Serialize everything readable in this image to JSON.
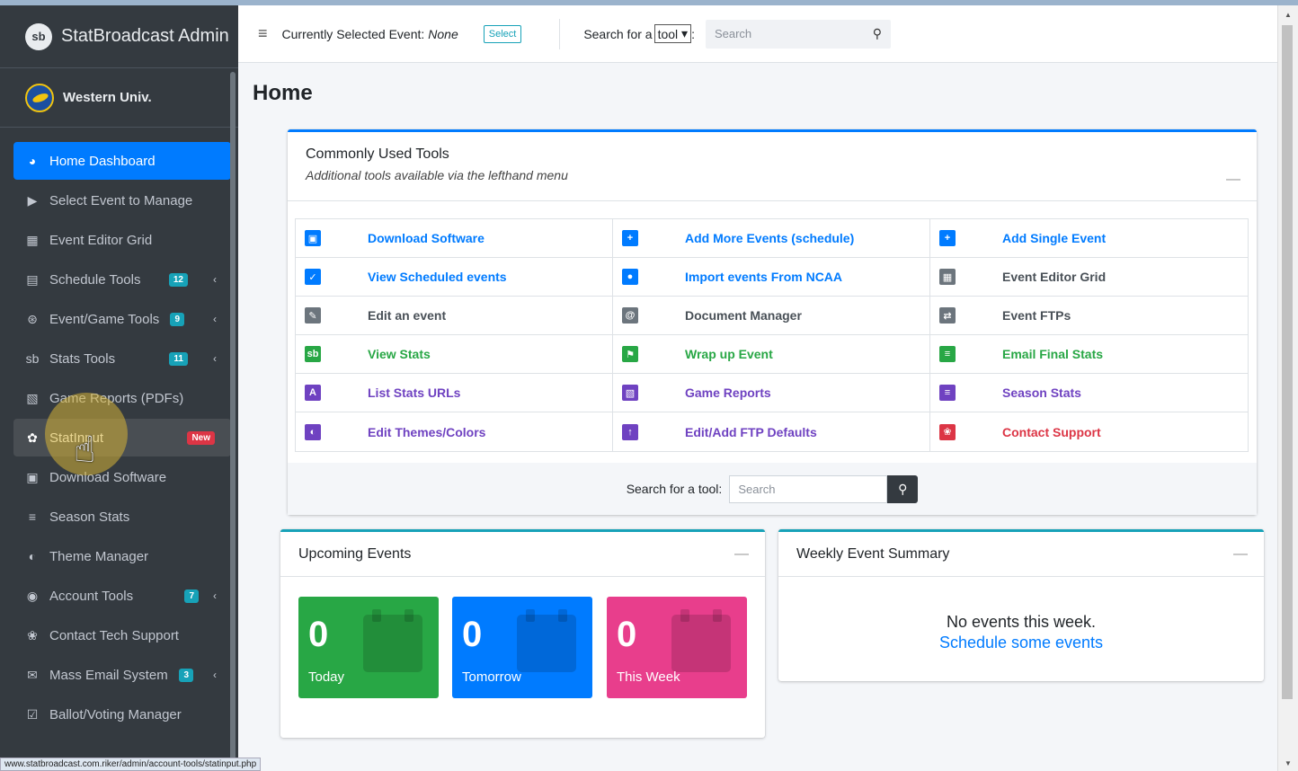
{
  "brand": {
    "title": "StatBroadcast Admin",
    "logo_text": "sb"
  },
  "user": {
    "name": "Western Univ."
  },
  "sidebar": {
    "items": [
      {
        "label": "Home Dashboard",
        "icon": "◕",
        "active": true
      },
      {
        "label": "Select Event to Manage",
        "icon": "▶"
      },
      {
        "label": "Event Editor Grid",
        "icon": "▦"
      },
      {
        "label": "Schedule Tools",
        "icon": "▤",
        "badge": "12",
        "chevron": "‹"
      },
      {
        "label": "Event/Game Tools",
        "icon": "⊛",
        "badge": "9",
        "chevron": "‹"
      },
      {
        "label": "Stats Tools",
        "icon": "sb",
        "badge": "11",
        "chevron": "‹"
      },
      {
        "label": "Game Reports (PDFs)",
        "icon": "▧"
      },
      {
        "label": "StatInput",
        "icon": "✿",
        "badge": "New",
        "hover": true
      },
      {
        "label": "Download Software",
        "icon": "▣"
      },
      {
        "label": "Season Stats",
        "icon": "≡"
      },
      {
        "label": "Theme Manager",
        "icon": "◐"
      },
      {
        "label": "Account Tools",
        "icon": "◉",
        "badge": "7",
        "chevron": "‹"
      },
      {
        "label": "Contact Tech Support",
        "icon": "❀"
      },
      {
        "label": "Mass Email System",
        "icon": "✉",
        "badge": "3",
        "chevron": "‹"
      },
      {
        "label": "Ballot/Voting Manager",
        "icon": "☑"
      }
    ]
  },
  "status_url": "www.statbroadcast.com.riker/admin/account-tools/statinput.php",
  "header": {
    "hamburger": "≡",
    "selected_label": "Currently Selected Event:",
    "selected_value": "None",
    "select_button": "Select",
    "search_label": "Search for a",
    "search_type": "tool",
    "search_placeholder": "Search",
    "search_icon": "⚲"
  },
  "page": {
    "title": "Home"
  },
  "tools_card": {
    "title": "Commonly Used Tools",
    "subtitle": "Additional tools available via the lefthand menu",
    "collapse": "—",
    "tools": [
      {
        "label": "Download Software",
        "icon": "▣",
        "icon_color": "#007bff",
        "text_color": "#007bff"
      },
      {
        "label": "Add More Events (schedule)",
        "icon": "+",
        "icon_color": "#007bff",
        "text_color": "#007bff"
      },
      {
        "label": "Add Single Event",
        "icon": "+",
        "icon_color": "#007bff",
        "text_color": "#007bff"
      },
      {
        "label": "View Scheduled events",
        "icon": "✓",
        "icon_color": "#007bff",
        "text_color": "#007bff"
      },
      {
        "label": "Import events From NCAA",
        "icon": "●",
        "icon_color": "#007bff",
        "text_color": "#007bff"
      },
      {
        "label": "Event Editor Grid",
        "icon": "▦",
        "icon_color": "#6c757d",
        "text_color": "#495057"
      },
      {
        "label": "Edit an event",
        "icon": "✎",
        "icon_color": "#6c757d",
        "text_color": "#495057"
      },
      {
        "label": "Document Manager",
        "icon": "@",
        "icon_color": "#6c757d",
        "text_color": "#495057"
      },
      {
        "label": "Event FTPs",
        "icon": "⇄",
        "icon_color": "#6c757d",
        "text_color": "#495057"
      },
      {
        "label": "View Stats",
        "icon": "sb",
        "icon_color": "#28a745",
        "text_color": "#28a745"
      },
      {
        "label": "Wrap up Event",
        "icon": "⚑",
        "icon_color": "#28a745",
        "text_color": "#28a745"
      },
      {
        "label": "Email Final Stats",
        "icon": "≡",
        "icon_color": "#28a745",
        "text_color": "#28a745"
      },
      {
        "label": "List Stats URLs",
        "icon": "A",
        "icon_color": "#6f42c1",
        "text_color": "#6f42c1"
      },
      {
        "label": "Game Reports",
        "icon": "▧",
        "icon_color": "#6f42c1",
        "text_color": "#6f42c1"
      },
      {
        "label": "Season Stats",
        "icon": "≡",
        "icon_color": "#6f42c1",
        "text_color": "#6f42c1"
      },
      {
        "label": "Edit Themes/Colors",
        "icon": "◐",
        "icon_color": "#6f42c1",
        "text_color": "#6f42c1"
      },
      {
        "label": "Edit/Add FTP Defaults",
        "icon": "↑",
        "icon_color": "#6f42c1",
        "text_color": "#6f42c1"
      },
      {
        "label": "Contact Support",
        "icon": "❀",
        "icon_color": "#dc3545",
        "text_color": "#dc3545"
      }
    ],
    "footer_label": "Search for a tool:",
    "footer_placeholder": "Search",
    "footer_icon": "⚲"
  },
  "upcoming": {
    "title": "Upcoming Events",
    "collapse": "—",
    "boxes": [
      {
        "value": "0",
        "label": "Today",
        "color": "#28a745"
      },
      {
        "value": "0",
        "label": "Tomorrow",
        "color": "#007bff"
      },
      {
        "value": "0",
        "label": "This Week",
        "color": "#e83e8c"
      }
    ]
  },
  "weekly": {
    "title": "Weekly Event Summary",
    "collapse": "—",
    "empty_text": "No events this week.",
    "link_text": "Schedule some events"
  },
  "cursor_icon": "☝"
}
